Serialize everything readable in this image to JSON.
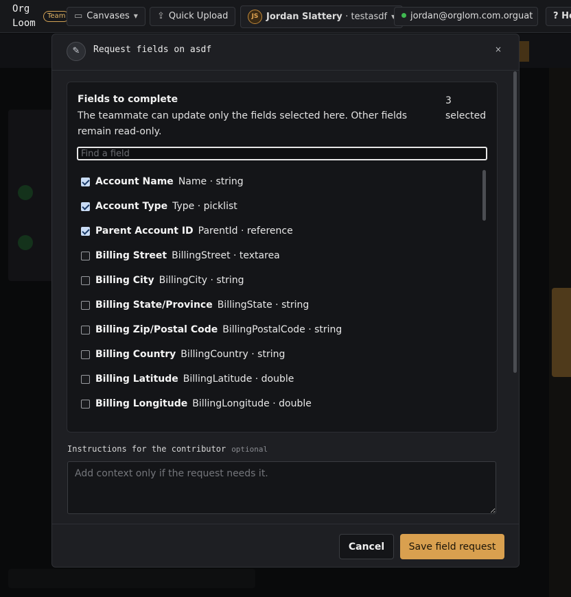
{
  "app": {
    "logo_line1": "Org",
    "logo_line2": "Loom",
    "team_badge": "Team"
  },
  "topbar": {
    "canvases_label": "Canvases",
    "quick_upload_label": "Quick Upload",
    "user_initials": "JS",
    "user_name": "Jordan Slattery",
    "workspace": "· testasdf",
    "org_email": "jordan@orglom.com.orguat",
    "help_label": "? Help"
  },
  "modal": {
    "title": "Request fields on asdf",
    "close_glyph": "×",
    "fields_heading": "Fields to complete",
    "fields_description": "The teammate can update only the fields selected here. Other fields remain read-only.",
    "selected_count": "3",
    "selected_label": "selected",
    "search_placeholder": "Find a field",
    "fields": [
      {
        "label": "Account Name",
        "api": "Name · string",
        "checked": true
      },
      {
        "label": "Account Type",
        "api": "Type · picklist",
        "checked": true
      },
      {
        "label": "Parent Account ID",
        "api": "ParentId · reference",
        "checked": true
      },
      {
        "label": "Billing Street",
        "api": "BillingStreet · textarea",
        "checked": false
      },
      {
        "label": "Billing City",
        "api": "BillingCity · string",
        "checked": false
      },
      {
        "label": "Billing State/Province",
        "api": "BillingState · string",
        "checked": false
      },
      {
        "label": "Billing Zip/Postal Code",
        "api": "BillingPostalCode · string",
        "checked": false
      },
      {
        "label": "Billing Country",
        "api": "BillingCountry · string",
        "checked": false
      },
      {
        "label": "Billing Latitude",
        "api": "BillingLatitude · double",
        "checked": false
      },
      {
        "label": "Billing Longitude",
        "api": "BillingLongitude · double",
        "checked": false
      }
    ],
    "instructions_label": "Instructions for the contributor",
    "instructions_optional": "optional",
    "instructions_placeholder": "Add context only if the request needs it.",
    "cancel_label": "Cancel",
    "save_label": "Save field request"
  },
  "colors": {
    "accent": "#d9a04f",
    "checkbox_on": "#c9dcf5",
    "status_dot": "#3fb950"
  }
}
